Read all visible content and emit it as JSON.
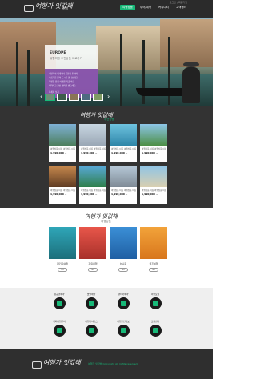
{
  "header": {
    "logo_text": "여행가 잇값해",
    "logo_tag": "여행",
    "util": "로그인 | 회원가입",
    "nav": [
      "여행상품",
      "투어/예약",
      "커뮤니티",
      "고객센터"
    ]
  },
  "hero": {
    "title": "EUROPE",
    "subtitle": "유럽여행 추천상품 바로가기",
    "lines": [
      "이탈리아 베네치아 곤돌라 투어와",
      "아름다운 물의 도시를 만나보세요.",
      "특별한 유럽 여행을 지금 바로",
      "예약하고 할인 혜택을 받으세요.",
      "자세히 보기"
    ]
  },
  "recommended": {
    "title": "여행가 잇값해",
    "subtitle": "추천상품",
    "items": [
      {
        "title": "여행상품 이름 여행상품 이름",
        "price": "1,990,000 ~"
      },
      {
        "title": "여행상품 이름 여행상품 이름",
        "price": "1,990,000 ~"
      },
      {
        "title": "여행상품 이름 여행상품 이름",
        "price": "1,990,000 ~"
      },
      {
        "title": "여행상품 이름 여행상품 이름",
        "price": "1,990,000 ~"
      },
      {
        "title": "여행상품 이름 여행상품 이름",
        "price": "1,990,000 ~"
      },
      {
        "title": "여행상품 이름 여행상품 이름",
        "price": "1,990,000 ~"
      },
      {
        "title": "여행상품 이름 여행상품 이름",
        "price": "1,990,000 ~"
      },
      {
        "title": "여행상품 이름 여행상품 이름",
        "price": "1,990,000 ~"
      }
    ]
  },
  "products": {
    "title": "여행가 잇값해",
    "subtitle": "여행상품",
    "items": [
      {
        "label": "패키지여행",
        "button": "Go"
      },
      {
        "label": "자유여행",
        "button": "Go"
      },
      {
        "label": "허니문",
        "button": "Go"
      },
      {
        "label": "골프여행",
        "button": "Go"
      }
    ]
  },
  "services": {
    "items": [
      "항공권예약",
      "호텔예약",
      "렌터카예약",
      "여행보험",
      "해외여행준비",
      "여행자서비스",
      "여행안전정보",
      "고객센터"
    ]
  },
  "footer": {
    "text": "여행가 잇값해 Copyright All rights reserved."
  }
}
